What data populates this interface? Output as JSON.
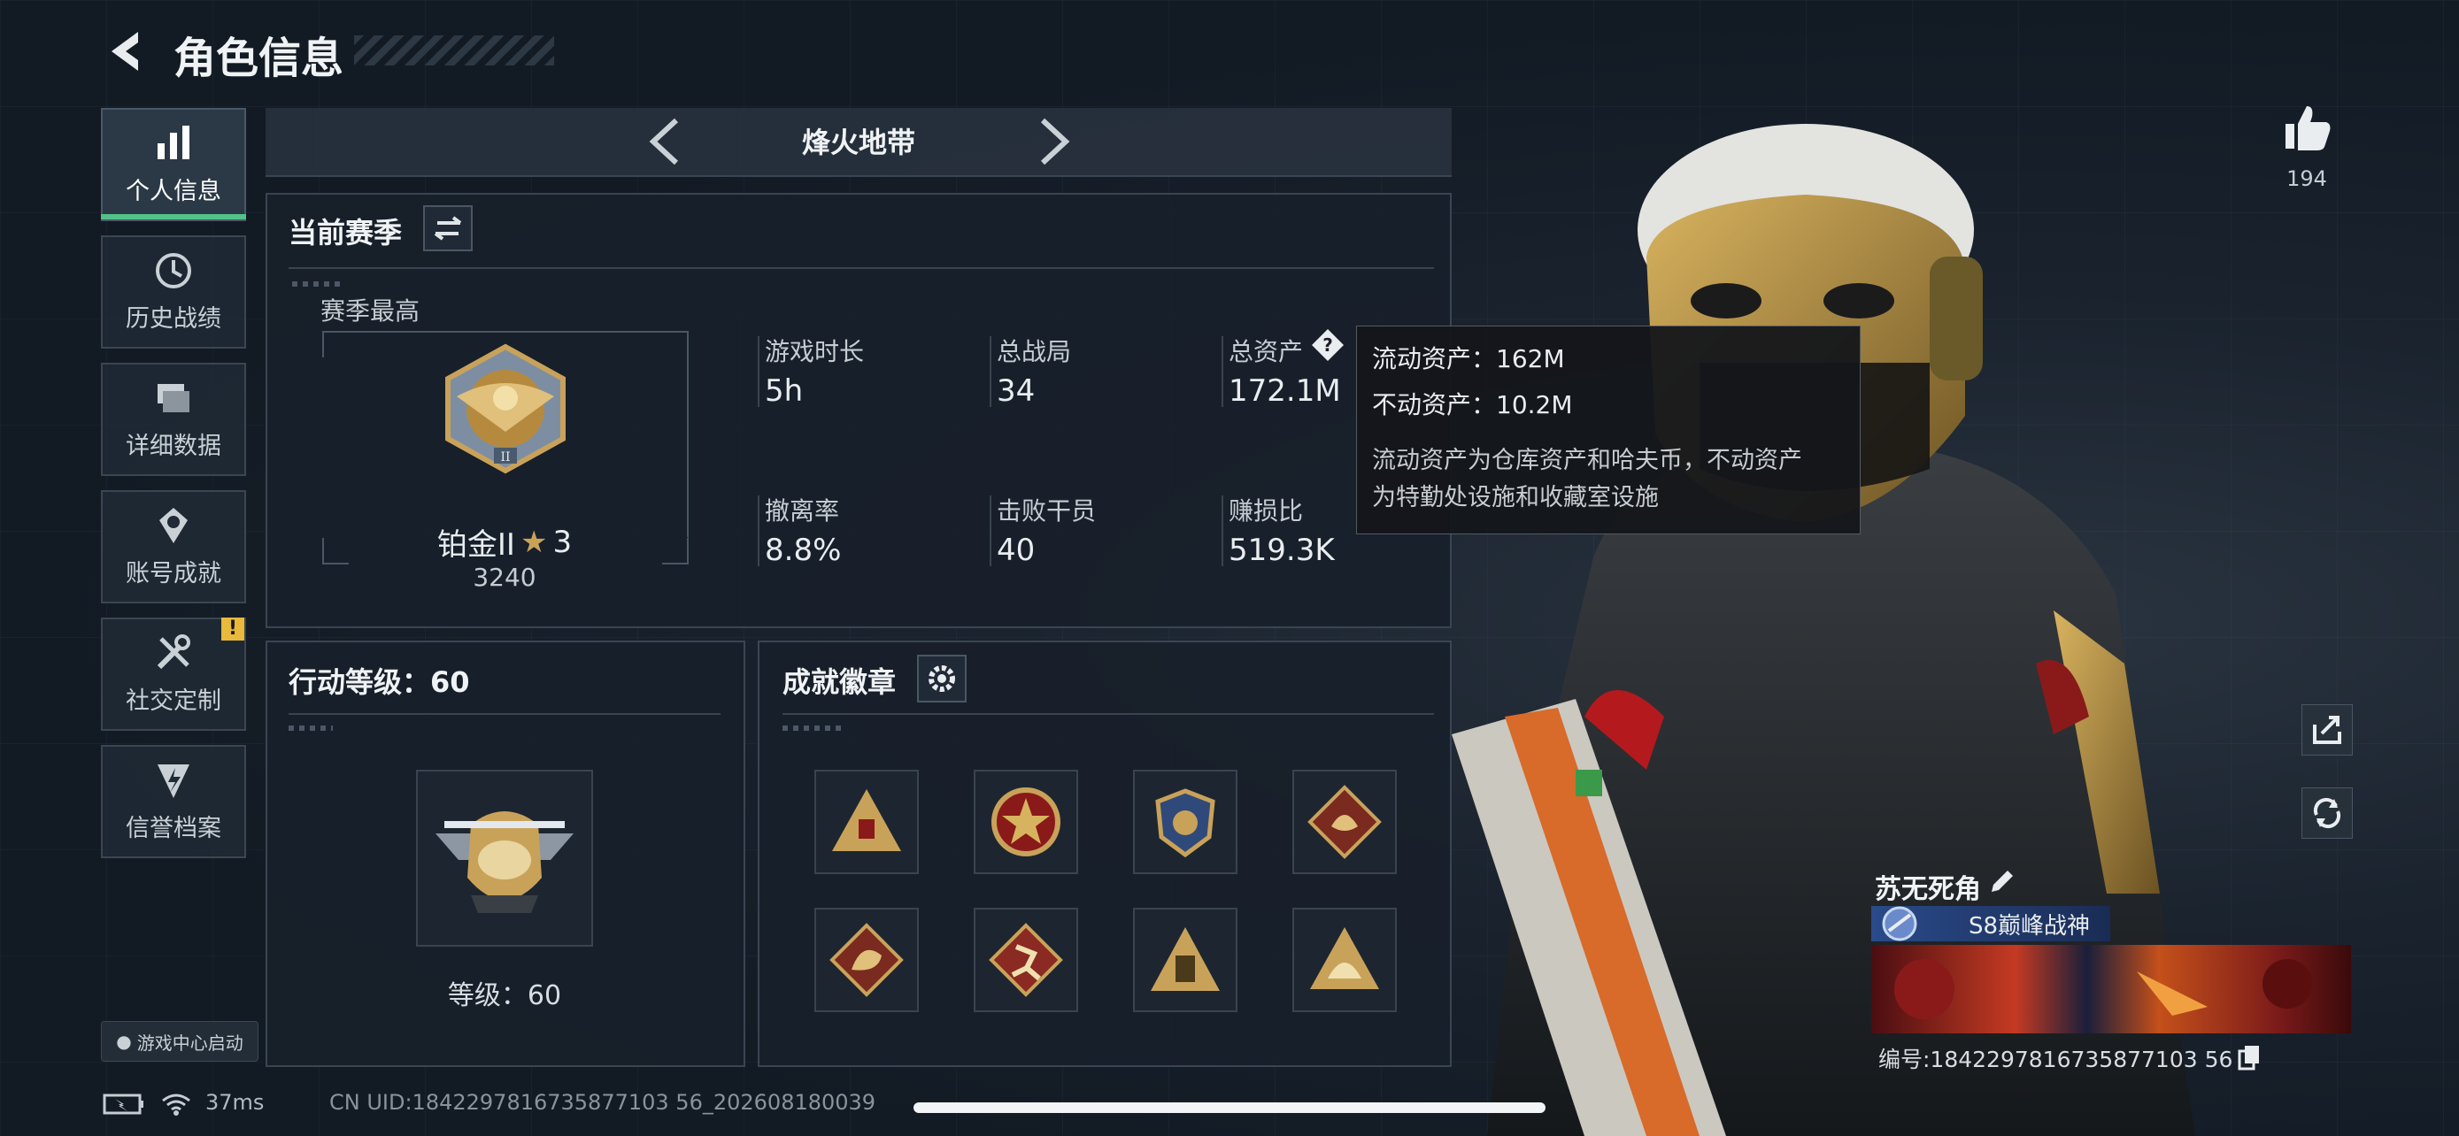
{
  "header": {
    "title": "角色信息"
  },
  "sidebar": {
    "items": [
      {
        "label": "个人信息",
        "icon": "bar-chart-icon",
        "active": true
      },
      {
        "label": "历史战绩",
        "icon": "history-clock-icon"
      },
      {
        "label": "详细数据",
        "icon": "folders-icon"
      },
      {
        "label": "账号成就",
        "icon": "achievement-medal-icon"
      },
      {
        "label": "社交定制",
        "icon": "tools-icon",
        "alert": "!"
      },
      {
        "label": "信誉档案",
        "icon": "shield-bolt-icon"
      }
    ],
    "game_center": "游戏中心启动"
  },
  "mode_selector": {
    "label": "烽火地带"
  },
  "season": {
    "title": "当前赛季",
    "best_label": "赛季最高",
    "rank_name": "铂金II",
    "rank_stars": "3",
    "rank_points": "3240",
    "stats": [
      {
        "label": "游戏时长",
        "value": "5h"
      },
      {
        "label": "总战局",
        "value": "34"
      },
      {
        "label": "总资产",
        "value": "172.1M"
      },
      {
        "label": "撤离率",
        "value": "8.8%"
      },
      {
        "label": "击败干员",
        "value": "40"
      },
      {
        "label": "赚损比",
        "value": "519.3K"
      }
    ]
  },
  "tooltip": {
    "liquid": "流动资产：162M",
    "fixed": "不动资产：10.2M",
    "desc_line1": "流动资产为仓库资产和哈夫币，不动资产",
    "desc_line2": "为特勤处设施和收藏室设施"
  },
  "action_level": {
    "title": "行动等级：60",
    "level_text": "等级：60"
  },
  "achievements": {
    "title": "成就徽章",
    "badges": [
      "triangle-badge-icon",
      "star-seal-badge-icon",
      "eagle-crest-badge-icon",
      "dragon-badge-icon",
      "dragon-head-badge-icon",
      "runner-badge-icon",
      "tower-badge-icon",
      "helmet-badge-icon"
    ]
  },
  "right_panel": {
    "likes": "194",
    "player_name": "苏无死角",
    "title_badge": "S8巅峰战神",
    "player_id": "编号:1842297816735877103 56"
  },
  "status_bar": {
    "ping": "37ms",
    "uid": "CN UID:1842297816735877103 56_202608180039"
  },
  "colors": {
    "accent_green": "#52c28a",
    "alert_yellow": "#e8b93a",
    "gold": "#c9a25a"
  }
}
